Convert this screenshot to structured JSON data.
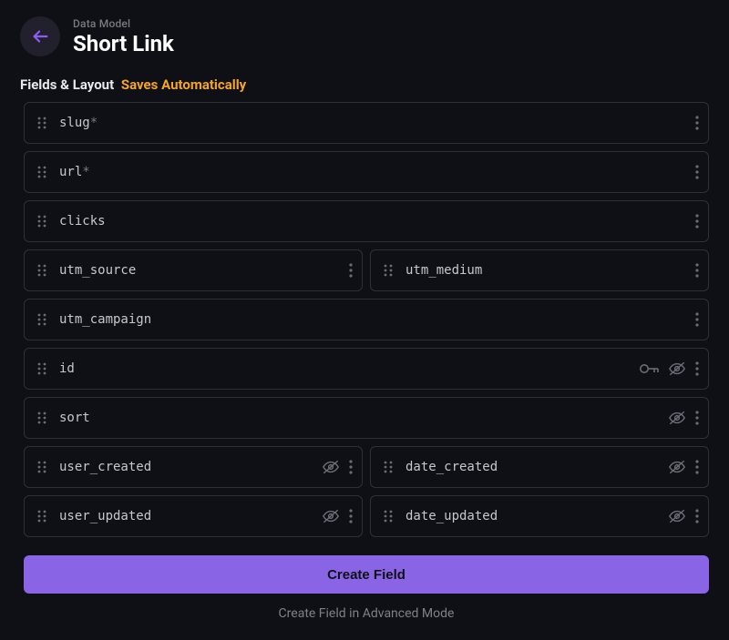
{
  "header": {
    "overline": "Data Model",
    "title": "Short Link"
  },
  "section": {
    "label": "Fields & Layout",
    "saves": "Saves Automatically"
  },
  "fields": [
    {
      "row": 0,
      "name": "slug",
      "required": true,
      "key": false,
      "hidden": false
    },
    {
      "row": 1,
      "name": "url",
      "required": true,
      "key": false,
      "hidden": false
    },
    {
      "row": 2,
      "name": "clicks",
      "required": false,
      "key": false,
      "hidden": false
    },
    {
      "row": 3,
      "name": "utm_source",
      "required": false,
      "key": false,
      "hidden": false
    },
    {
      "row": 3,
      "name": "utm_medium",
      "required": false,
      "key": false,
      "hidden": false
    },
    {
      "row": 4,
      "name": "utm_campaign",
      "required": false,
      "key": false,
      "hidden": false
    },
    {
      "row": 5,
      "name": "id",
      "required": false,
      "key": true,
      "hidden": true
    },
    {
      "row": 6,
      "name": "sort",
      "required": false,
      "key": false,
      "hidden": true
    },
    {
      "row": 7,
      "name": "user_created",
      "required": false,
      "key": false,
      "hidden": true
    },
    {
      "row": 7,
      "name": "date_created",
      "required": false,
      "key": false,
      "hidden": true
    },
    {
      "row": 8,
      "name": "user_updated",
      "required": false,
      "key": false,
      "hidden": true
    },
    {
      "row": 8,
      "name": "date_updated",
      "required": false,
      "key": false,
      "hidden": true
    }
  ],
  "actions": {
    "create": "Create Field",
    "advanced": "Create Field in Advanced Mode"
  }
}
